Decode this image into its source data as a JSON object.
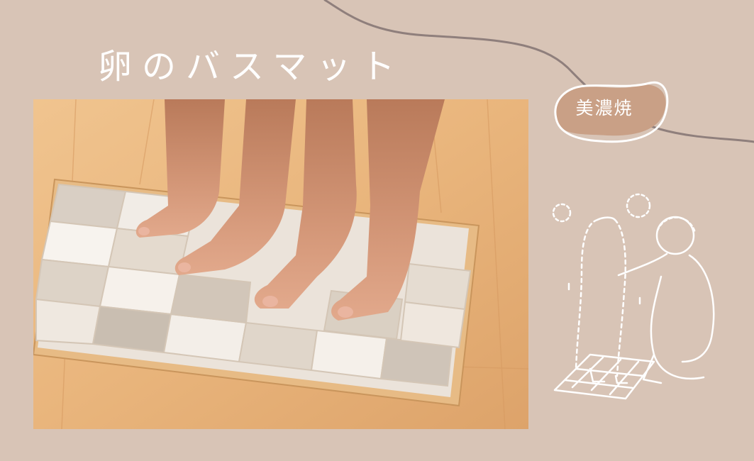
{
  "title": "卵のバスマット",
  "badge": "美濃焼",
  "colors": {
    "background": "#d8c4b6",
    "curve": "#8f7f7c",
    "badge_fill": "#c9a086",
    "badge_outline": "#ffffff",
    "title": "#ffffff"
  },
  "icons": {
    "photo": "feet-on-bath-mat-photo",
    "illustration": "child-and-parent-bath-illustration"
  }
}
